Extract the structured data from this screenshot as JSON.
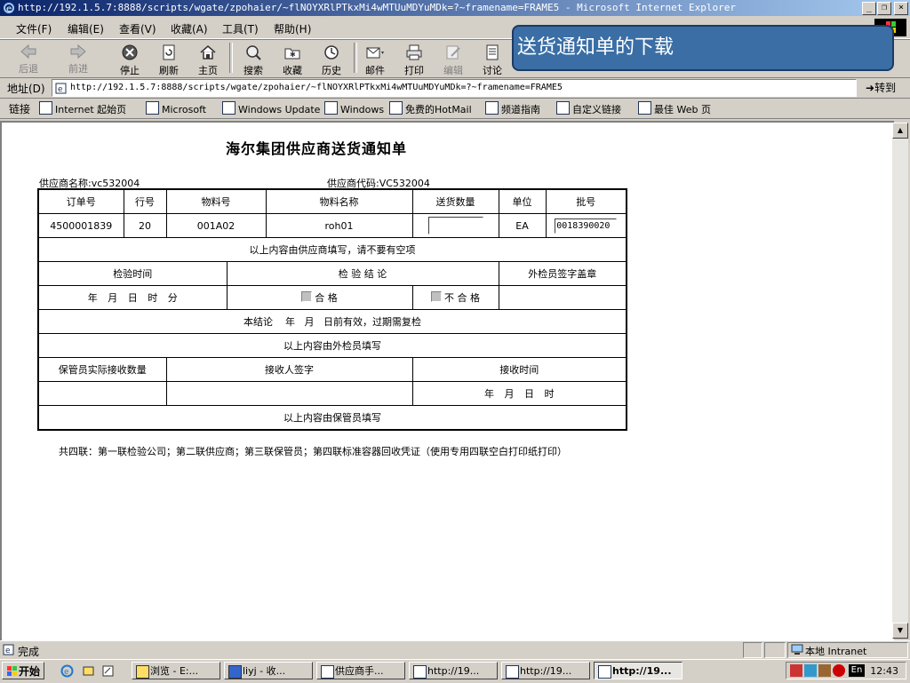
{
  "window": {
    "title": "http://192.1.5.7:8888/scripts/wgate/zpohaier/~flNOYXRlPTkxMi4wMTUuMDYuMDk=?~framename=FRAME5 - Microsoft Internet Explorer"
  },
  "menu": [
    "文件(F)",
    "编辑(E)",
    "查看(V)",
    "收藏(A)",
    "工具(T)",
    "帮助(H)"
  ],
  "toolbar": {
    "back": "后退",
    "forward": "前进",
    "stop": "停止",
    "refresh": "刷新",
    "home": "主页",
    "search": "搜索",
    "favorites": "收藏",
    "history": "历史",
    "mail": "邮件",
    "print": "打印",
    "edit": "编辑",
    "discuss": "讨论"
  },
  "address": {
    "label": "地址(D)",
    "url": "http://192.1.5.7:8888/scripts/wgate/zpohaier/~flNOYXRlPTkxMi4wMTUuMDYuMDk=?~framename=FRAME5",
    "go": "转到"
  },
  "links": {
    "label": "链接",
    "items": [
      "Internet 起始页",
      "Microsoft",
      "Windows Update",
      "Windows",
      "免费的HotMail",
      "频道指南",
      "自定义链接",
      "最佳 Web 页"
    ]
  },
  "overlay": {
    "text": "送货通知单的下载"
  },
  "doc": {
    "title": "海尔集团供应商送货通知单",
    "supplier_name_label": "供应商名称:",
    "supplier_name": "vc532004",
    "supplier_code_label": "供应商代码:",
    "supplier_code": "VC532004",
    "headers": [
      "订单号",
      "行号",
      "物料号",
      "物料名称",
      "送货数量",
      "单位",
      "批号"
    ],
    "row": {
      "order_no": "4500001839",
      "line_no": "20",
      "material_no": "001A02",
      "material_name": "roh01",
      "qty": "",
      "unit": "EA",
      "batch": "0018390020"
    },
    "note_supplier": "以上内容由供应商填写，请不要有空项",
    "inspect_time_label": "检验时间",
    "inspect_result_label": "检 验 结 论",
    "inspector_sign_label": "外检员签字盖章",
    "inspect_time_fmt": "年 月 日 时 分",
    "pass_label": "合 格",
    "fail_label": "不 合 格",
    "valid_note": "本结论    年   月   日前有效，过期需复检",
    "note_inspector": "以上内容由外检员填写",
    "keeper_qty_label": "保管员实际接收数量",
    "receiver_sign_label": "接收人签字",
    "receive_time_label": "接收时间",
    "receive_time_fmt": "年 月 日 时",
    "note_keeper": "以上内容由保管员填写",
    "footer": "共四联：第一联检验公司；第二联供应商；第三联保管员；第四联标准容器回收凭证（使用专用四联空白打印纸打印）"
  },
  "status": {
    "text": "完成",
    "zone": "本地 Intranet"
  },
  "taskbar": {
    "start": "开始",
    "tasks": [
      "浏览 - E:...",
      "liyj - 收...",
      "供应商手...",
      "http://19...",
      "http://19...",
      "http://19..."
    ],
    "lang": "En",
    "clock": "12:43"
  }
}
